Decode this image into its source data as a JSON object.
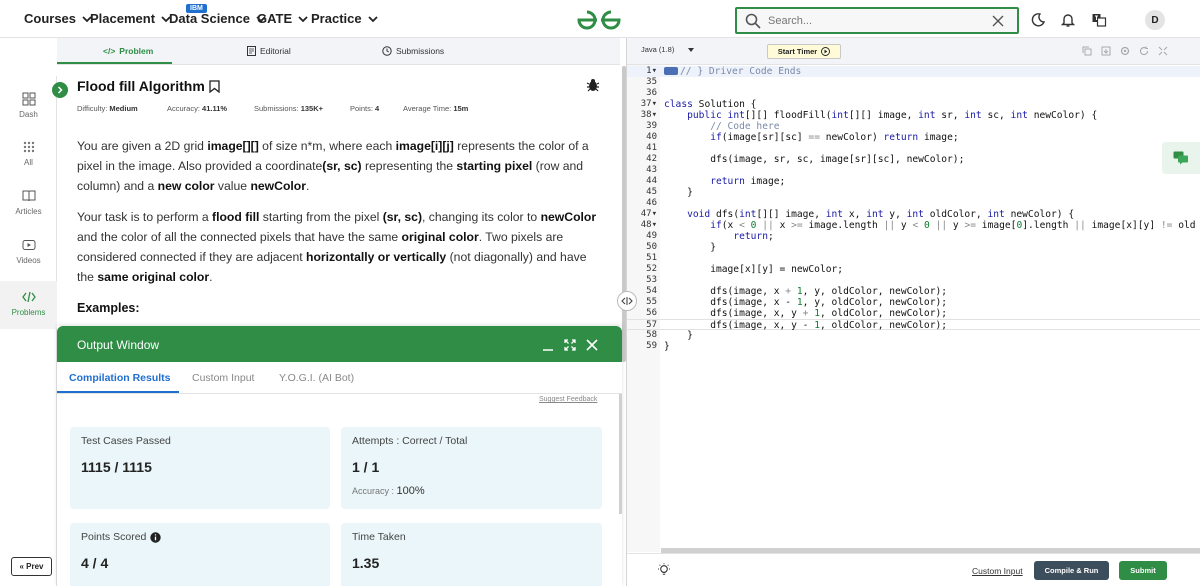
{
  "nav": {
    "items": [
      {
        "label": "Courses"
      },
      {
        "label": "Placement"
      },
      {
        "label": "Data Science"
      },
      {
        "label": "GATE"
      },
      {
        "label": "Practice"
      }
    ],
    "badge": "IBM",
    "search_placeholder": "Search...",
    "avatar_initial": "D"
  },
  "problem_tabs": [
    "Problem",
    "Editorial",
    "Submissions"
  ],
  "sidebar": {
    "items": [
      "Dash",
      "All",
      "Articles",
      "Videos",
      "Problems"
    ],
    "prev_label": "Prev"
  },
  "problem": {
    "title": "Flood fill Algorithm",
    "meta": {
      "difficulty_label": "Difficulty:",
      "difficulty": "Medium",
      "accuracy_label": "Accuracy:",
      "accuracy": "41.11%",
      "submissions_label": "Submissions:",
      "submissions": "135K+",
      "points_label": "Points:",
      "points": "4",
      "avg_time_label": "Average Time:",
      "avg_time": "15m"
    },
    "p1": {
      "t1": "You are given a 2D grid ",
      "b1": "image[][]",
      "t2": " of size n*m, where each ",
      "b2": "image[i][j]",
      "t3": " represents the color of a pixel in the image. Also provided a coordinate",
      "b3": "(sr, sc)",
      "t4": " representing the ",
      "b4": "starting pixel",
      "t5": " (row and column) and a ",
      "b5": "new color",
      "t6": " value ",
      "b6": "newColor",
      "t7": "."
    },
    "p2": {
      "t1": "Your task is to perform a ",
      "b1": "flood fill",
      "t2": " starting from the pixel ",
      "b2": "(sr, sc)",
      "t3": ", changing its color to ",
      "b3": "newColor",
      "t4": " and the color of all the connected pixels that have the same ",
      "b4": "original color",
      "t5": ". Two pixels are considered connected if they are adjacent ",
      "b5": "horizontally or vertically",
      "t6": " (not diagonally) and have the ",
      "b6": "same original color",
      "t7": "."
    },
    "examples_heading": "Examples:"
  },
  "output": {
    "title": "Output Window",
    "tabs": [
      "Compilation Results",
      "Custom Input",
      "Y.O.G.I. (AI Bot)"
    ],
    "suggest_feedback": "Suggest Feedback",
    "cards": {
      "test_cases": {
        "label": "Test Cases Passed",
        "value": "1115 / 1115"
      },
      "attempts": {
        "label": "Attempts : Correct / Total",
        "value": "1 / 1",
        "accuracy_label": "Accuracy :",
        "accuracy": "100%"
      },
      "points": {
        "label": "Points Scored",
        "value": "4 / 4"
      },
      "time": {
        "label": "Time Taken",
        "value": "1.35"
      }
    }
  },
  "editor": {
    "language": "Java (1.8)",
    "start_timer": "Start Timer",
    "lines": [
      {
        "n": "1",
        "fold": true,
        "code": "// } Driver Code Ends",
        "comment": true
      },
      {
        "n": "35",
        "code": ""
      },
      {
        "n": "36",
        "code": ""
      },
      {
        "n": "37",
        "fold": true,
        "code": "class Solution {"
      },
      {
        "n": "38",
        "fold": true,
        "code": "    public int[][] floodFill(int[][] image, int sr, int sc, int newColor) {"
      },
      {
        "n": "39",
        "code": "        // Code here",
        "comment": true
      },
      {
        "n": "40",
        "code": "        if(image[sr][sc] == newColor) return image;"
      },
      {
        "n": "41",
        "code": ""
      },
      {
        "n": "42",
        "code": "        dfs(image, sr, sc, image[sr][sc], newColor);"
      },
      {
        "n": "43",
        "code": ""
      },
      {
        "n": "44",
        "code": "        return image;"
      },
      {
        "n": "45",
        "code": "    }"
      },
      {
        "n": "46",
        "code": ""
      },
      {
        "n": "47",
        "fold": true,
        "code": "    void dfs(int[][] image, int x, int y, int oldColor, int newColor) {"
      },
      {
        "n": "48",
        "fold": true,
        "code": "        if(x < 0 || x >= image.length || y < 0 || y >= image[0].length || image[x][y] != old"
      },
      {
        "n": "49",
        "code": "            return;"
      },
      {
        "n": "50",
        "code": "        }"
      },
      {
        "n": "51",
        "code": ""
      },
      {
        "n": "52",
        "code": "        image[x][y] = newColor;"
      },
      {
        "n": "53",
        "code": ""
      },
      {
        "n": "54",
        "code": "        dfs(image, x + 1, y, oldColor, newColor);"
      },
      {
        "n": "55",
        "code": "        dfs(image, x - 1, y, oldColor, newColor);"
      },
      {
        "n": "56",
        "code": "        dfs(image, x, y + 1, oldColor, newColor);"
      },
      {
        "n": "57",
        "code": "        dfs(image, x, y - 1, oldColor, newColor);"
      },
      {
        "n": "58",
        "code": "    }"
      },
      {
        "n": "59",
        "code": "}"
      }
    ],
    "custom_input": "Custom Input",
    "compile_run": "Compile & Run",
    "submit": "Submit"
  },
  "colors": {
    "brand_green": "#2f8d46",
    "link_blue": "#1f6fd1",
    "compile_button": "#3c4d5c",
    "card_bg": "#eaf6f9"
  }
}
